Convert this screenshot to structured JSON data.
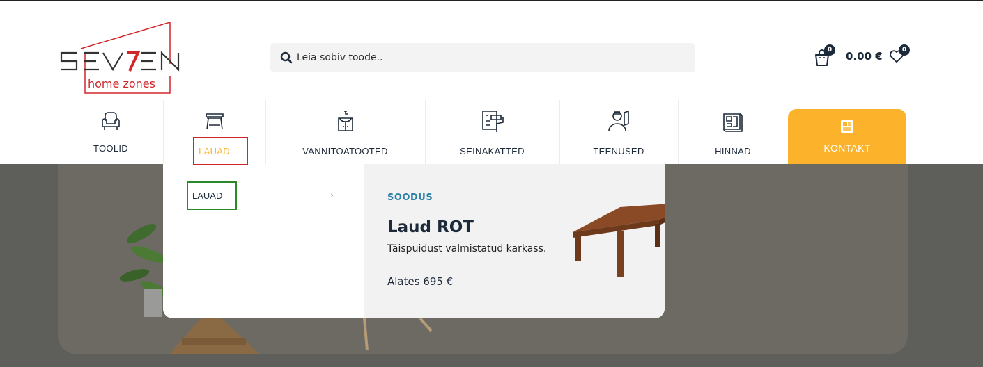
{
  "logo": {
    "alt": "Seven home zones"
  },
  "search": {
    "placeholder": "Leia sobiv toode.."
  },
  "cart": {
    "count": "0",
    "total": "0.00 €"
  },
  "wishlist": {
    "count": "0"
  },
  "nav": {
    "items": [
      {
        "label": "TOOLID",
        "icon": "armchair-icon"
      },
      {
        "label": "LAUAD",
        "icon": "desk-icon",
        "active_color": "#fcb32b"
      },
      {
        "label": "VANNITOATOOTED",
        "icon": "sink-cabinet-icon"
      },
      {
        "label": "SEINAKATTED",
        "icon": "paint-roller-wall-icon"
      },
      {
        "label": "TEENUSED",
        "icon": "worker-icon"
      },
      {
        "label": "HINNAD",
        "icon": "blueprint-icon"
      },
      {
        "label": "KONTAKT",
        "icon": "contact-card-icon"
      }
    ]
  },
  "dropdown": {
    "category": "LAUAD",
    "promo": {
      "tag": "SOODUS",
      "title": "Laud ROT",
      "description": "Täispuidust valmistatud karkass.",
      "price": "Alates 695 €"
    }
  },
  "colors": {
    "accent": "#fcb32b",
    "navy": "#1d2a3a",
    "promo_tag": "#2b7fa8",
    "brand_red": "#d0262a"
  }
}
